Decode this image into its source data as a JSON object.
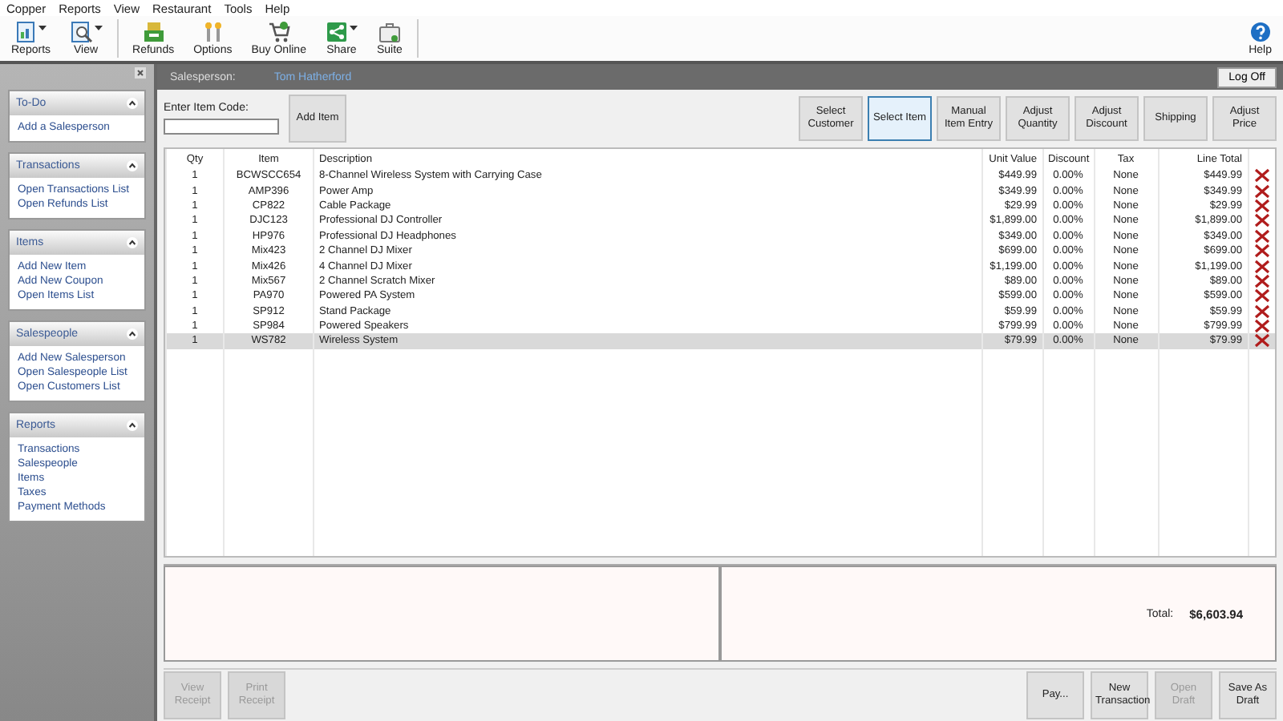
{
  "menu": [
    "Copper",
    "Reports",
    "View",
    "Restaurant",
    "Tools",
    "Help"
  ],
  "toolbar": [
    {
      "label": "Reports",
      "dropdown": true
    },
    {
      "label": "View",
      "dropdown": true
    },
    {
      "label": "Refunds",
      "dropdown": false
    },
    {
      "label": "Options",
      "dropdown": false
    },
    {
      "label": "Buy Online",
      "dropdown": false
    },
    {
      "label": "Share",
      "dropdown": true
    },
    {
      "label": "Suite",
      "dropdown": false
    }
  ],
  "help": {
    "label": "Help"
  },
  "sidebar": [
    {
      "title": "To-Do",
      "links": [
        "Add a Salesperson"
      ]
    },
    {
      "title": "Transactions",
      "links": [
        "Open Transactions List",
        "Open Refunds List"
      ]
    },
    {
      "title": "Items",
      "links": [
        "Add New Item",
        "Add New Coupon",
        "Open Items List"
      ]
    },
    {
      "title": "Salespeople",
      "links": [
        "Add New Salesperson",
        "Open Salespeople List",
        "Open Customers List"
      ]
    },
    {
      "title": "Reports",
      "links": [
        "Transactions",
        "Salespeople",
        "Items",
        "Taxes",
        "Payment Methods"
      ]
    }
  ],
  "header": {
    "salesperson_label": "Salesperson:",
    "salesperson": "Tom Hatherford",
    "logoff": "Log Off"
  },
  "item_code": {
    "label": "Enter Item Code:",
    "add": "Add Item"
  },
  "actions": [
    {
      "label": "Select Customer",
      "selected": false
    },
    {
      "label": "Select Item",
      "selected": true
    },
    {
      "label": "Manual Item Entry",
      "selected": false
    },
    {
      "label": "Adjust Quantity",
      "selected": false
    },
    {
      "label": "Adjust Discount",
      "selected": false
    },
    {
      "label": "Shipping",
      "selected": false
    },
    {
      "label": "Adjust Price",
      "selected": false
    }
  ],
  "table": {
    "columns": [
      "Qty",
      "Item",
      "Description",
      "Unit Value",
      "Discount",
      "Tax",
      "Line Total"
    ],
    "rows": [
      {
        "cells": [
          "1",
          "BCWSCC654",
          "8-Channel Wireless System with Carrying Case",
          "$449.99",
          "0.00%",
          "None",
          "$449.99"
        ],
        "selected": false
      },
      {
        "cells": [
          "1",
          "AMP396",
          "Power Amp",
          "$349.99",
          "0.00%",
          "None",
          "$349.99"
        ],
        "selected": false
      },
      {
        "cells": [
          "1",
          "CP822",
          "Cable Package",
          "$29.99",
          "0.00%",
          "None",
          "$29.99"
        ],
        "selected": false
      },
      {
        "cells": [
          "1",
          "DJC123",
          "Professional DJ Controller",
          "$1,899.00",
          "0.00%",
          "None",
          "$1,899.00"
        ],
        "selected": false
      },
      {
        "cells": [
          "1",
          "HP976",
          "Professional DJ Headphones",
          "$349.00",
          "0.00%",
          "None",
          "$349.00"
        ],
        "selected": false
      },
      {
        "cells": [
          "1",
          "Mix423",
          "2 Channel DJ Mixer",
          "$699.00",
          "0.00%",
          "None",
          "$699.00"
        ],
        "selected": false
      },
      {
        "cells": [
          "1",
          "Mix426",
          "4 Channel DJ Mixer",
          "$1,199.00",
          "0.00%",
          "None",
          "$1,199.00"
        ],
        "selected": false
      },
      {
        "cells": [
          "1",
          "Mix567",
          "2 Channel Scratch Mixer",
          "$89.00",
          "0.00%",
          "None",
          "$89.00"
        ],
        "selected": false
      },
      {
        "cells": [
          "1",
          "PA970",
          "Powered PA System",
          "$599.00",
          "0.00%",
          "None",
          "$599.00"
        ],
        "selected": false
      },
      {
        "cells": [
          "1",
          "SP912",
          "Stand Package",
          "$59.99",
          "0.00%",
          "None",
          "$59.99"
        ],
        "selected": false
      },
      {
        "cells": [
          "1",
          "SP984",
          "Powered Speakers",
          "$799.99",
          "0.00%",
          "None",
          "$799.99"
        ],
        "selected": false
      },
      {
        "cells": [
          "1",
          "WS782",
          "Wireless System",
          "$79.99",
          "0.00%",
          "None",
          "$79.99"
        ],
        "selected": true
      }
    ]
  },
  "total": {
    "label": "Total:",
    "value": "$6,603.94"
  },
  "left_buttons": [
    {
      "label": "View Receipt",
      "disabled": true
    },
    {
      "label": "Print Receipt",
      "disabled": true
    }
  ],
  "right_buttons": [
    {
      "label": "Pay...",
      "disabled": false
    },
    {
      "label": "New Transaction",
      "disabled": false
    },
    {
      "label": "Open Draft",
      "disabled": true
    },
    {
      "label": "Save As Draft",
      "disabled": false
    }
  ]
}
